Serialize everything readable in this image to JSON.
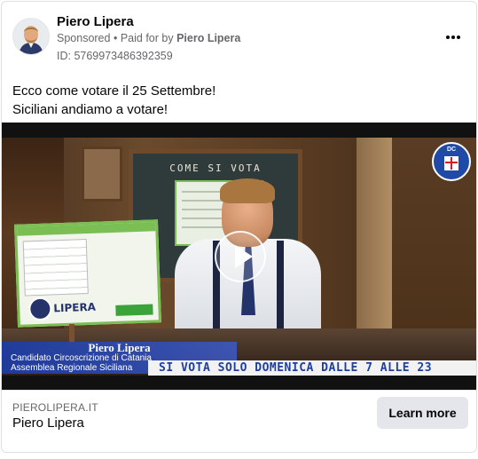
{
  "post": {
    "page_name": "Piero Lipera",
    "sponsored": "Sponsored",
    "separator": "•",
    "paid_for_prefix": "Paid for by",
    "paid_for_name": "Piero Lipera",
    "ad_id": "ID: 5769973486392359",
    "more_icon": "more-horizontal-icon",
    "caption_line1": "Ecco come votare il 25 Settembre!",
    "caption_line2": "Siciliani andiamo a votare!"
  },
  "video": {
    "blackboard_title": "COME SI VOTA",
    "poster_word": "LIPERA",
    "dc_logo_text": "DC",
    "lower_third_name": "Piero Lipera",
    "lower_third_role1": "Candidato Circoscrizione di Catania",
    "lower_third_role2": "Assemblea Regionale Siciliana",
    "ticker": "SI VOTA SOLO DOMENICA DALLE 7 ALLE 23",
    "play_icon": "play-icon",
    "colors": {
      "ticker_text": "#1f3fa0",
      "lower_third": "#1e3ca0",
      "poster_green": "#7bbf54"
    }
  },
  "footer": {
    "domain": "PIEROLIPERA.IT",
    "title": "Piero Lipera",
    "cta_label": "Learn more"
  }
}
